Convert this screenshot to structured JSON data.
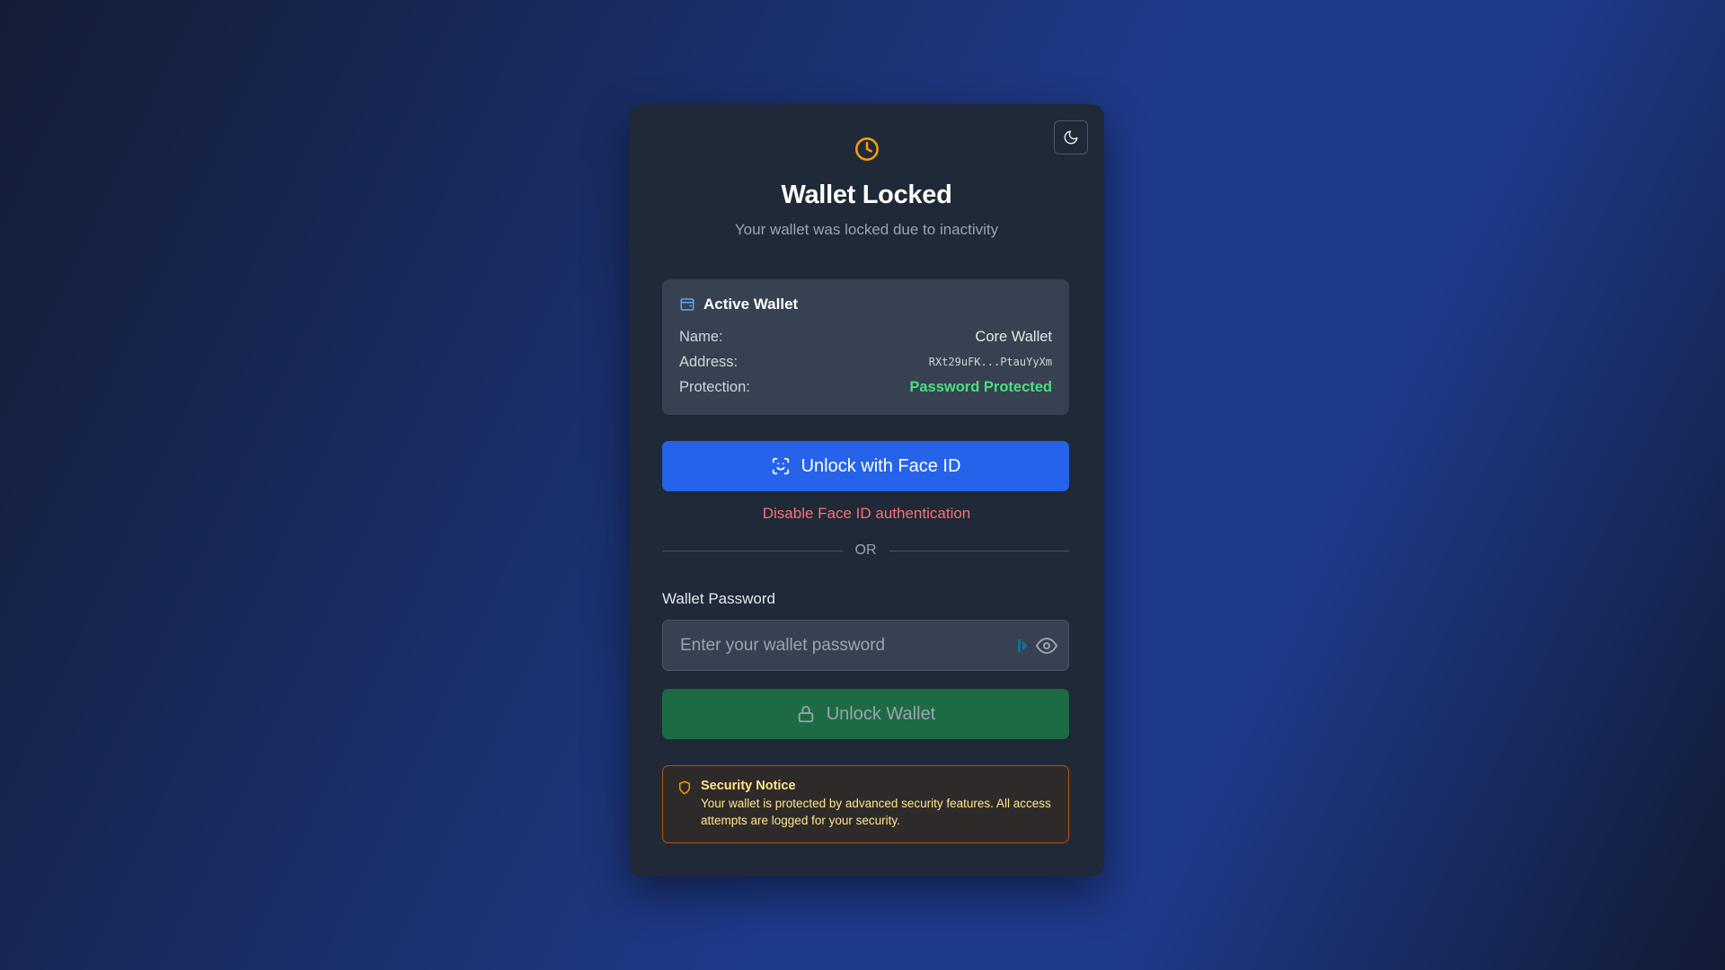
{
  "theme_toggle": {
    "icon": "moon-icon"
  },
  "header": {
    "icon": "clock-icon",
    "title": "Wallet Locked",
    "subtitle": "Your wallet was locked due to inactivity"
  },
  "wallet": {
    "heading": "Active Wallet",
    "rows": [
      {
        "label": "Name:",
        "value": "Core Wallet"
      },
      {
        "label": "Address:",
        "value": "RXt29uFK...PtauYyXm"
      },
      {
        "label": "Protection:",
        "value": "Password Protected"
      }
    ]
  },
  "faceid": {
    "button_label": "Unlock with Face ID",
    "disable_label": "Disable Face ID authentication"
  },
  "divider": {
    "text": "OR"
  },
  "password": {
    "label": "Wallet Password",
    "placeholder": "Enter your wallet password",
    "value": ""
  },
  "unlock": {
    "button_label": "Unlock Wallet"
  },
  "notice": {
    "title": "Security Notice",
    "text": "Your wallet is protected by advanced security features. All access attempts are logged for your security."
  },
  "colors": {
    "accent_blue": "#2563eb",
    "success_green": "#4ade80",
    "unlock_green": "#1d6b44",
    "warning_amber": "#f59e0b",
    "danger_red": "#f87171"
  }
}
